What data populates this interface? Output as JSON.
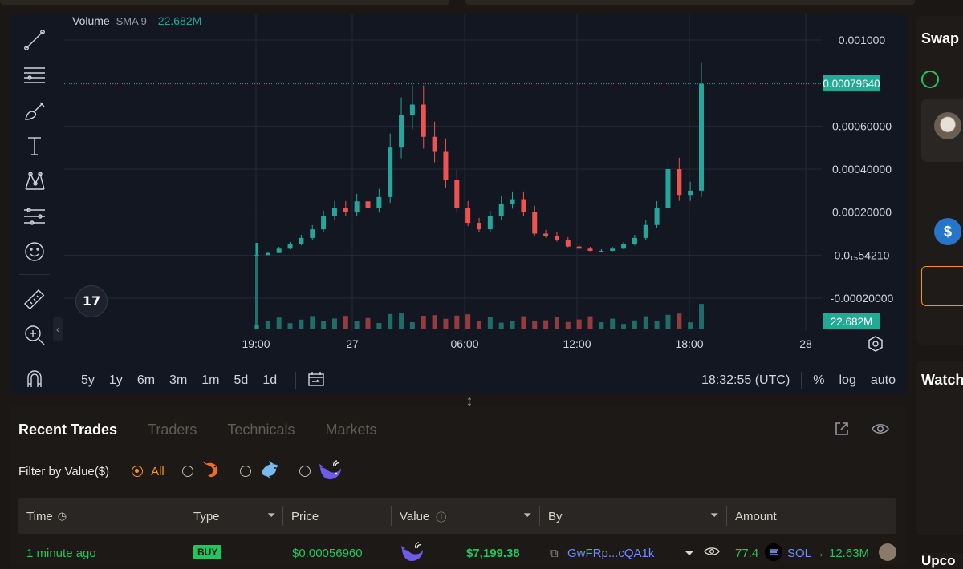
{
  "chart": {
    "volume_legend": {
      "label": "Volume",
      "indicator": "SMA 9",
      "value": "22.682M"
    },
    "price_axis_ticks": [
      "0.001000",
      "0.00060000",
      "0.00040000",
      "0.00020000",
      "0.0₁₅54210",
      "-0.00020000"
    ],
    "current_price_tag": "0.00079640",
    "volume_tag": "22.682M",
    "time_axis_ticks": [
      "19:00",
      "27",
      "06:00",
      "12:00",
      "18:00",
      "28"
    ],
    "timeframes": [
      "5y",
      "1y",
      "6m",
      "3m",
      "1m",
      "5d",
      "1d"
    ],
    "clock": "18:32:55 (UTC)",
    "scale_options": [
      "%",
      "log",
      "auto"
    ],
    "colors": {
      "up": "#26a69a",
      "down": "#ef5350",
      "background": "#131722"
    }
  },
  "chart_data": {
    "type": "candlestick",
    "title": "",
    "xlabel": "",
    "ylabel": "",
    "x_ticks": [
      "19:00",
      "27",
      "06:00",
      "12:00",
      "18:00",
      "28"
    ],
    "y_ticks": [
      "0.001000",
      "0.00060000",
      "0.00040000",
      "0.00020000",
      "0.0₁₅54210",
      "-0.00020000"
    ],
    "candles_close_approx": [
      1e-07,
      1e-05,
      3e-05,
      5e-05,
      8e-05,
      0.00012,
      0.00018,
      0.00022,
      0.0002,
      0.00025,
      0.00022,
      0.00027,
      0.0005,
      0.00065,
      0.0007,
      0.00055,
      0.00048,
      0.00035,
      0.00022,
      0.00015,
      0.00012,
      0.00018,
      0.00024,
      0.00026,
      0.0002,
      0.0001,
      9e-05,
      7e-05,
      4e-05,
      3e-05,
      2e-05,
      2e-05,
      3e-05,
      5e-05,
      8e-05,
      0.00014,
      0.00022,
      0.0004,
      0.00028,
      0.0003,
      0.0007964
    ],
    "last_price": 0.0007964,
    "volume_last": "22.682M"
  },
  "trades": {
    "tabs": [
      "Recent Trades",
      "Traders",
      "Technicals",
      "Markets"
    ],
    "filter_label": "Filter by Value($)",
    "filter_all": "All",
    "columns": [
      "Time",
      "Type",
      "Price",
      "Value",
      "By",
      "Amount"
    ],
    "rows": [
      {
        "time": "1 minute ago",
        "type": "BUY",
        "price": "$0.00056960",
        "value": "$7,199.38",
        "by": "GwFRp...cQA1k",
        "amount_sol": "77.4",
        "sol_label": "SOL",
        "amount_tokens": "12.63M"
      }
    ]
  },
  "sidebar": {
    "swap_title": "Swap",
    "watch_title": "Watch",
    "upcoming_title": "Upco"
  },
  "icons": [
    "trendline-icon",
    "horizontal-lines-icon",
    "brush-icon",
    "text-icon",
    "pattern-icon",
    "fib-icon",
    "emoji-icon",
    "ruler-icon",
    "zoom-icon",
    "magnet-icon",
    "tradingview-logo",
    "external-link-icon",
    "eye-icon"
  ]
}
